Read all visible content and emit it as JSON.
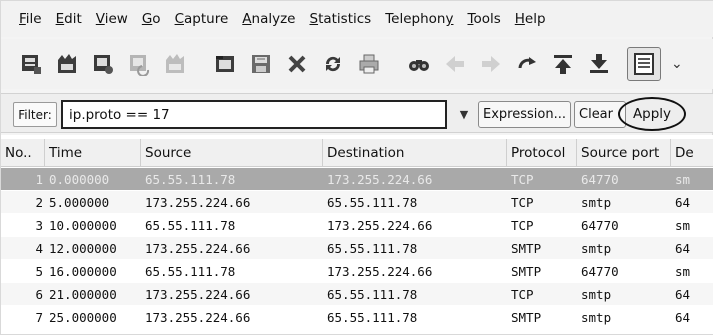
{
  "menu": [
    {
      "label": "File"
    },
    {
      "label": "Edit"
    },
    {
      "label": "View"
    },
    {
      "label": "Go"
    },
    {
      "label": "Capture"
    },
    {
      "label": "Analyze"
    },
    {
      "label": "Statistics"
    },
    {
      "label": "Telephony"
    },
    {
      "label": "Tools"
    },
    {
      "label": "Help"
    }
  ],
  "toolbar": {
    "icons": [
      "open-interfaces-icon",
      "start-capture-icon",
      "options-icon",
      "restart-capture-icon",
      "stop-capture-icon",
      "open-file-icon",
      "save-file-icon",
      "close-file-icon",
      "reload-icon",
      "print-icon",
      "find-packet-icon",
      "go-back-icon",
      "go-forward-icon",
      "go-to-packet-icon",
      "go-to-first-icon",
      "go-to-last-icon",
      "colorize-icon"
    ],
    "more": "⌄"
  },
  "filter": {
    "label": "Filter:",
    "value": "ip.proto == 17",
    "expression_label": "Expression...",
    "clear_label": "Clear",
    "apply_label": "Apply"
  },
  "packet_list": {
    "columns": [
      "No..",
      "Time",
      "Source",
      "Destination",
      "Protocol",
      "Source port",
      "De"
    ],
    "rows": [
      {
        "no": "1",
        "time": "0.000000",
        "source": "65.55.111.78",
        "destination": "173.255.224.66",
        "protocol": "TCP",
        "source_port": "64770",
        "dest": "sm",
        "selected": true
      },
      {
        "no": "2",
        "time": "5.000000",
        "source": "173.255.224.66",
        "destination": "65.55.111.78",
        "protocol": "TCP",
        "source_port": "smtp",
        "dest": "64",
        "selected": false
      },
      {
        "no": "3",
        "time": "10.000000",
        "source": "65.55.111.78",
        "destination": "173.255.224.66",
        "protocol": "TCP",
        "source_port": "64770",
        "dest": "sm",
        "selected": false
      },
      {
        "no": "4",
        "time": "12.000000",
        "source": "173.255.224.66",
        "destination": "65.55.111.78",
        "protocol": "SMTP",
        "source_port": "smtp",
        "dest": "64",
        "selected": false
      },
      {
        "no": "5",
        "time": "16.000000",
        "source": "65.55.111.78",
        "destination": "173.255.224.66",
        "protocol": "SMTP",
        "source_port": "64770",
        "dest": "sm",
        "selected": false
      },
      {
        "no": "6",
        "time": "21.000000",
        "source": "173.255.224.66",
        "destination": "65.55.111.78",
        "protocol": "TCP",
        "source_port": "smtp",
        "dest": "64",
        "selected": false
      },
      {
        "no": "7",
        "time": "25.000000",
        "source": "173.255.224.66",
        "destination": "65.55.111.78",
        "protocol": "SMTP",
        "source_port": "smtp",
        "dest": "64",
        "selected": false
      }
    ]
  },
  "colors": {
    "selected_row": "#a9a9a9",
    "menubar_bg": "#f2f2f2"
  }
}
